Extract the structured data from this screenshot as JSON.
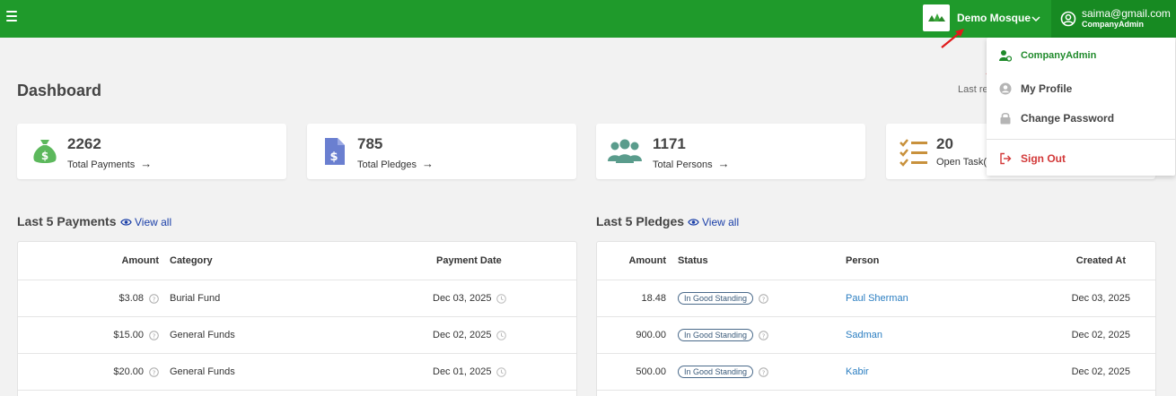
{
  "header": {
    "org_name": "Demo Mosque",
    "user_email": "saima@gmail.com",
    "user_role": "CompanyAdmin"
  },
  "page": {
    "title": "Dashboard",
    "last_refresh_label": "Last re"
  },
  "stats": [
    {
      "value": "2262",
      "label": "Total Payments",
      "icon": "money-bag-icon",
      "color": "#5cb85c"
    },
    {
      "value": "785",
      "label": "Total Pledges",
      "icon": "invoice-dollar-icon",
      "color": "#6a7fd0"
    },
    {
      "value": "1171",
      "label": "Total Persons",
      "icon": "users-icon",
      "color": "#5a9c8c"
    },
    {
      "value": "20",
      "label": "Open Task(s",
      "icon": "task-list-icon",
      "color": "#c8913c"
    }
  ],
  "payments": {
    "title": "Last 5 Payments",
    "view_all": "View all",
    "columns": [
      "Amount",
      "Category",
      "Payment Date"
    ],
    "rows": [
      {
        "amount": "$3.08",
        "category": "Burial Fund",
        "date": "Dec 03, 2025"
      },
      {
        "amount": "$15.00",
        "category": "General Funds",
        "date": "Dec 02, 2025"
      },
      {
        "amount": "$20.00",
        "category": "General Funds",
        "date": "Dec 01, 2025"
      }
    ]
  },
  "pledges": {
    "title": "Last 5 Pledges",
    "view_all": "View all",
    "columns": [
      "Amount",
      "Status",
      "Person",
      "Created At"
    ],
    "rows": [
      {
        "amount": "18.48",
        "status": "In Good Standing",
        "person": "Paul Sherman",
        "created": "Dec 03, 2025"
      },
      {
        "amount": "900.00",
        "status": "In Good Standing",
        "person": "Sadman",
        "created": "Dec 02, 2025"
      },
      {
        "amount": "500.00",
        "status": "In Good Standing",
        "person": "Kabir",
        "created": "Dec 02, 2025"
      }
    ]
  },
  "user_menu": {
    "items": [
      {
        "label": "CompanyAdmin",
        "icon": "user-gear-icon"
      },
      {
        "label": "My Profile",
        "icon": "user-circle-icon"
      },
      {
        "label": "Change Password",
        "icon": "lock-icon"
      },
      {
        "label": "Sign Out",
        "icon": "sign-out-icon"
      }
    ]
  },
  "colors": {
    "brand_green": "#1f9a2b",
    "link_blue": "#2b7ec1",
    "danger_red": "#d23838"
  }
}
